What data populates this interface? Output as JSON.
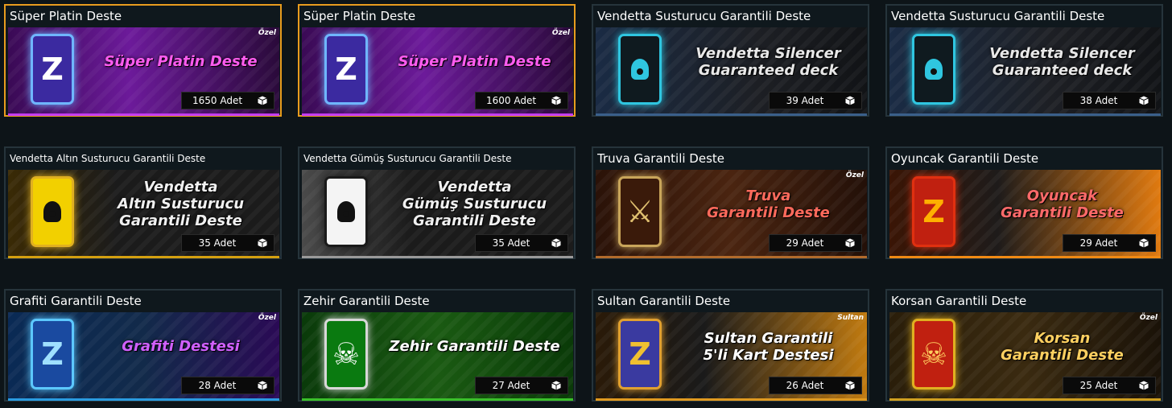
{
  "cards": [
    {
      "title": "Süper Platin Deste",
      "banner": "Süper Platin Deste",
      "tag": "Özel",
      "count": "1650 Adet",
      "icon": "z-deck-icon",
      "theme": "purple"
    },
    {
      "title": "Süper Platin Deste",
      "banner": "Süper Platin Deste",
      "tag": "Özel",
      "count": "1600 Adet",
      "icon": "z-deck-icon",
      "theme": "purple"
    },
    {
      "title": "Vendetta Susturucu Garantili Deste",
      "banner": "Vendetta Silencer\nGuaranteed deck",
      "tag": "",
      "count": "39 Adet",
      "icon": "silencer-deck-icon",
      "theme": "blue"
    },
    {
      "title": "Vendetta Susturucu Garantili Deste",
      "banner": "Vendetta Silencer\nGuaranteed deck",
      "tag": "",
      "count": "38 Adet",
      "icon": "silencer-deck-icon",
      "theme": "blue"
    },
    {
      "title": "Vendetta Altın Susturucu Garantili Deste",
      "banner": "Vendetta\nAltın Susturucu\nGarantili Deste",
      "tag": "",
      "count": "35 Adet",
      "icon": "gold-silencer-deck-icon",
      "theme": "gold"
    },
    {
      "title": "Vendetta Gümüş Susturucu Garantili Deste",
      "banner": "Vendetta\nGümüş Susturucu\nGarantili Deste",
      "tag": "",
      "count": "35 Adet",
      "icon": "silver-silencer-deck-icon",
      "theme": "silver"
    },
    {
      "title": "Truva Garantili Deste",
      "banner": "Truva\nGarantili Deste",
      "tag": "Özel",
      "count": "29 Adet",
      "icon": "truva-deck-icon",
      "theme": "bronze"
    },
    {
      "title": "Oyuncak Garantili Deste",
      "banner": "Oyuncak\nGarantili Deste",
      "tag": "",
      "count": "29 Adet",
      "icon": "z-red-deck-icon",
      "theme": "orange"
    },
    {
      "title": "Grafiti Garantili Deste",
      "banner": "Grafiti Destesi",
      "tag": "Özel",
      "count": "28 Adet",
      "icon": "z-graffiti-deck-icon",
      "theme": "graffiti"
    },
    {
      "title": "Zehir Garantili Deste",
      "banner": "Zehir Garantili Deste",
      "tag": "",
      "count": "27 Adet",
      "icon": "skull-deck-icon",
      "theme": "green"
    },
    {
      "title": "Sultan Garantili Deste",
      "banner": "Sultan Garantili\n5'li Kart Destesi",
      "tag": "Sultan",
      "count": "26 Adet",
      "icon": "z-sultan-deck-icon",
      "theme": "sultan"
    },
    {
      "title": "Korsan Garantili Deste",
      "banner": "Korsan\nGarantili Deste",
      "tag": "Özel",
      "count": "25 Adet",
      "icon": "pirate-deck-icon",
      "theme": "pirate"
    }
  ],
  "selected": [
    0,
    1
  ],
  "themes": {
    "purple": {
      "bg": "linear-gradient(90deg,#3a0a55 0%,#6c1a9a 45%,#2a0a3a 100%)",
      "accent": "#c43cf0",
      "text": "#ff5cf0",
      "icon_border": "#6fb6ff",
      "icon_bg": "#3b2aa0",
      "glyph": "Z",
      "glyph_color": "#ffffff"
    },
    "blue": {
      "bg": "linear-gradient(90deg,#1a2b44 0%,#1d1f24 60%,#111316 100%)",
      "accent": "#3a5f8a",
      "text": "#e8e8e8",
      "icon_border": "#2fc6e0",
      "icon_bg": "#0f1a1f",
      "glyph": "cut",
      "glyph_color": "#2fc6e0"
    },
    "gold": {
      "bg": "linear-gradient(90deg,#3a2a05 0%,#1b1b1b 40%,#1b1b1b 100%)",
      "accent": "#d4a010",
      "text": "#f0f0f0",
      "icon_border": "#e0b020",
      "icon_bg": "#f2d000",
      "glyph": "cut",
      "glyph_color": "#111111"
    },
    "silver": {
      "bg": "linear-gradient(90deg,#4a4a4a 0%,#1b1b1b 40%,#1b1b1b 100%)",
      "accent": "#9a9a9a",
      "text": "#f0f0f0",
      "icon_border": "#1a1a1a",
      "icon_bg": "#f4f4f4",
      "glyph": "cut",
      "glyph_color": "#111111"
    },
    "bronze": {
      "bg": "linear-gradient(90deg,#2a1208 0%,#4a2410 50%,#231008 100%)",
      "accent": "#b26b2c",
      "text": "#ff6a5c",
      "icon_border": "#c8a55a",
      "icon_bg": "#3a1a0a",
      "glyph": "⚔",
      "glyph_color": "#e0c070"
    },
    "orange": {
      "bg": "linear-gradient(90deg,#3a1505 0%,#1e1b1a 40%,#e07a10 100%)",
      "accent": "#f08a14",
      "text": "#ff6a6a",
      "icon_border": "#e03010",
      "icon_bg": "#c02010",
      "glyph": "Z",
      "glyph_color": "#ffb000"
    },
    "graffiti": {
      "bg": "linear-gradient(90deg,#0a2a55 0%,#122a4a 50%,#2a0a55 100%)",
      "accent": "#2a9be0",
      "text": "#d060ff",
      "icon_border": "#5cc8ff",
      "icon_bg": "#1a4aa0",
      "glyph": "Z",
      "glyph_color": "#9fe0ff"
    },
    "green": {
      "bg": "linear-gradient(90deg,#0a3a0a 0%,#1a5a12 50%,#0a3a08 100%)",
      "accent": "#3ac02a",
      "text": "#ffffff",
      "icon_border": "#d8d8d8",
      "icon_bg": "#0a7a10",
      "glyph": "☠",
      "glyph_color": "#ffffff"
    },
    "sultan": {
      "bg": "linear-gradient(90deg,#2a1a08 0%,#1a1a1a 40%,#c07a10 100%)",
      "accent": "#e09a20",
      "text": "#ffffff",
      "icon_border": "#e0a030",
      "icon_bg": "#3a3aa0",
      "glyph": "Z",
      "glyph_color": "#f0c030"
    },
    "pirate": {
      "bg": "linear-gradient(90deg,#2a1e0a 0%,#3a2a10 50%,#1a1208 100%)",
      "accent": "#d0a020",
      "text": "#ffd060",
      "icon_border": "#e0b020",
      "icon_bg": "#c02010",
      "glyph": "☠",
      "glyph_color": "#ffd060"
    }
  }
}
